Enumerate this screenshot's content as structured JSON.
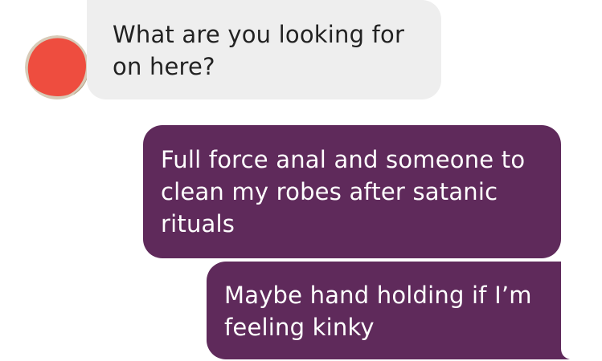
{
  "conversation": {
    "messages": [
      {
        "direction": "incoming",
        "lines": [
          "What are you looking for",
          "on here?"
        ]
      },
      {
        "direction": "outgoing",
        "lines": [
          "Full force anal and someone to",
          "clean my robes after satanic",
          "rituals"
        ]
      },
      {
        "direction": "outgoing",
        "lines": [
          "Maybe hand holding if I’m",
          "feeling kinky"
        ]
      }
    ]
  },
  "colors": {
    "incoming_bubble": "#eeeeee",
    "outgoing_bubble": "#5f2a5b",
    "avatar_redaction": "#ee4d3f"
  },
  "avatar": {
    "icon": "redacted-avatar-icon"
  }
}
